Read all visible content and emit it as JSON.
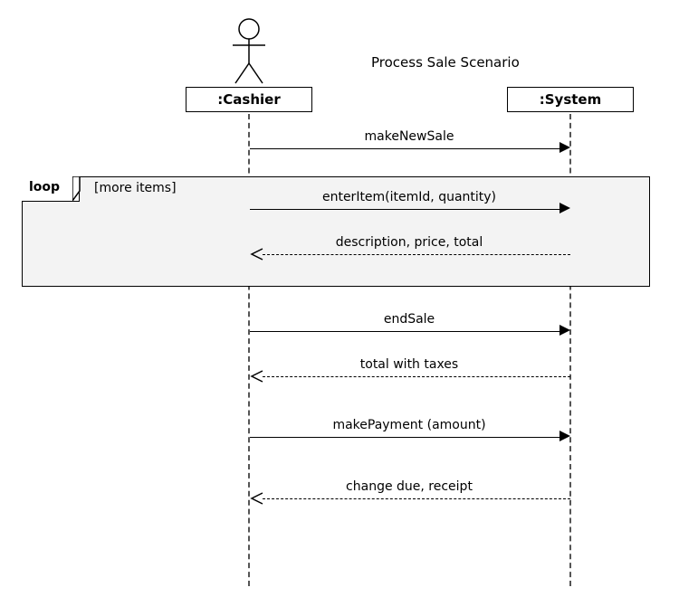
{
  "title": "Process Sale Scenario",
  "participants": {
    "cashier": ":Cashier",
    "system": ":System"
  },
  "loop": {
    "label": "loop",
    "guard": "[more items]"
  },
  "messages": {
    "m1": "makeNewSale",
    "m2": "enterItem(itemId, quantity)",
    "m3": "description, price, total",
    "m4": "endSale",
    "m5": "total with taxes",
    "m6": "makePayment (amount)",
    "m7": "change due, receipt"
  },
  "chart_data": {
    "type": "sequence-diagram",
    "title": "Process Sale Scenario",
    "participants": [
      {
        "id": "cashier",
        "name": ":Cashier",
        "actor": true
      },
      {
        "id": "system",
        "name": ":System",
        "actor": false
      }
    ],
    "fragments": [
      {
        "type": "loop",
        "label": "loop",
        "guard": "[more items]",
        "covers_messages": [
          2,
          3
        ]
      }
    ],
    "messages": [
      {
        "from": "cashier",
        "to": "system",
        "text": "makeNewSale",
        "style": "sync"
      },
      {
        "from": "cashier",
        "to": "system",
        "text": "enterItem(itemId, quantity)",
        "style": "sync"
      },
      {
        "from": "system",
        "to": "cashier",
        "text": "description, price, total",
        "style": "return"
      },
      {
        "from": "cashier",
        "to": "system",
        "text": "endSale",
        "style": "sync"
      },
      {
        "from": "system",
        "to": "cashier",
        "text": "total with taxes",
        "style": "return"
      },
      {
        "from": "cashier",
        "to": "system",
        "text": "makePayment (amount)",
        "style": "sync"
      },
      {
        "from": "system",
        "to": "cashier",
        "text": "change due, receipt",
        "style": "return"
      }
    ]
  }
}
